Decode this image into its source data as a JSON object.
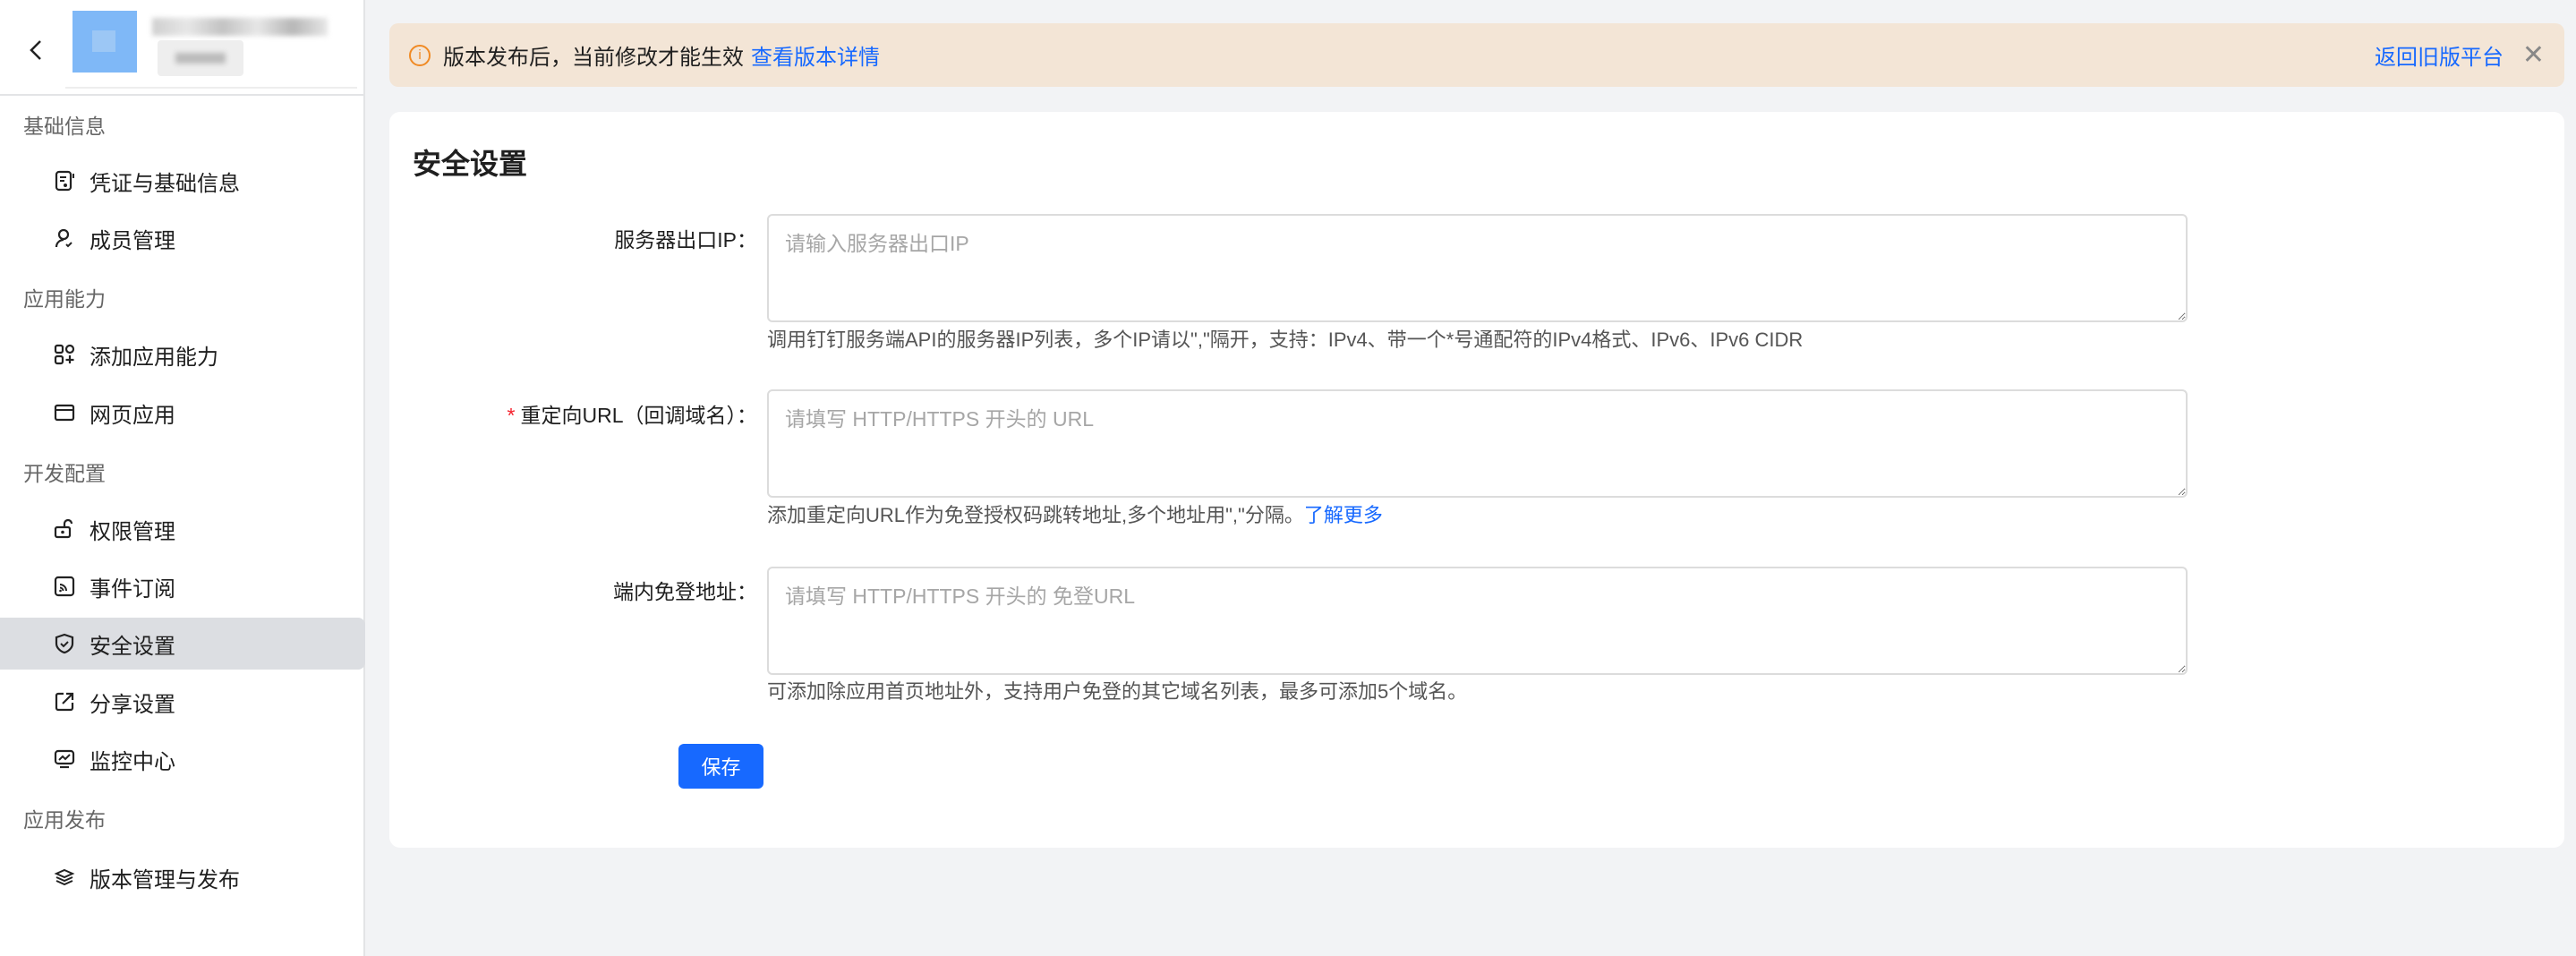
{
  "sidebar": {
    "back_icon": "chevron-left-icon",
    "sections": [
      {
        "label": "基础信息",
        "items": [
          {
            "label": "凭证与基础信息",
            "icon": "credential-icon"
          },
          {
            "label": "成员管理",
            "icon": "user-icon"
          }
        ]
      },
      {
        "label": "应用能力",
        "items": [
          {
            "label": "添加应用能力",
            "icon": "add-capability-icon"
          },
          {
            "label": "网页应用",
            "icon": "browser-icon"
          }
        ]
      },
      {
        "label": "开发配置",
        "items": [
          {
            "label": "权限管理",
            "icon": "unlock-icon"
          },
          {
            "label": "事件订阅",
            "icon": "rss-icon"
          },
          {
            "label": "安全设置",
            "icon": "shield-icon",
            "active": true
          },
          {
            "label": "分享设置",
            "icon": "share-icon"
          },
          {
            "label": "监控中心",
            "icon": "monitor-icon"
          }
        ]
      },
      {
        "label": "应用发布",
        "items": [
          {
            "label": "版本管理与发布",
            "icon": "layers-icon"
          }
        ]
      }
    ]
  },
  "banner": {
    "message": "版本发布后，当前修改才能生效",
    "link": "查看版本详情",
    "old_platform": "返回旧版平台",
    "accent": "#1769ff",
    "warning_color": "#f08a24"
  },
  "main": {
    "title": "安全设置",
    "fields": [
      {
        "label": "服务器出口IP：",
        "required": false,
        "placeholder": "请输入服务器出口IP",
        "value": "",
        "help": "调用钉钉服务端API的服务器IP列表，多个IP请以\",\"隔开，支持：IPv4、带一个*号通配符的IPv4格式、IPv6、IPv6 CIDR"
      },
      {
        "label": "重定向URL（回调域名）：",
        "required": true,
        "required_mark": "*",
        "placeholder": "请填写 HTTP/HTTPS 开头的 URL",
        "value": "",
        "help": "添加重定向URL作为免登授权码跳转地址,多个地址用\",\"分隔。",
        "help_link": "了解更多"
      },
      {
        "label": "端内免登地址：",
        "required": false,
        "placeholder": "请填写 HTTP/HTTPS 开头的 免登URL",
        "value": "",
        "help": "可添加除应用首页地址外，支持用户免登的其它域名列表，最多可添加5个域名。"
      }
    ],
    "save_label": "保存"
  }
}
